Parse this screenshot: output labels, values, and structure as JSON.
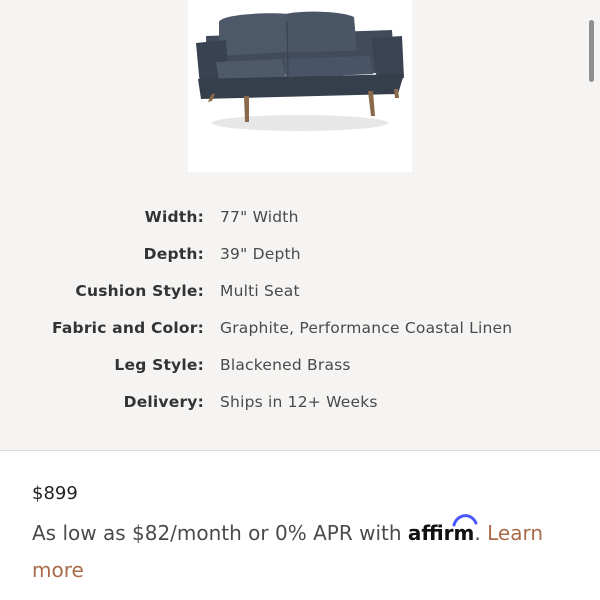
{
  "product": {
    "image_alt": "Graphite sofa",
    "price": "$899"
  },
  "specs": [
    {
      "label": "Width:",
      "value": "77\" Width"
    },
    {
      "label": "Depth:",
      "value": "39\" Depth"
    },
    {
      "label": "Cushion Style:",
      "value": "Multi Seat"
    },
    {
      "label": "Fabric and Color:",
      "value": "Graphite, Performance Coastal Linen"
    },
    {
      "label": "Leg Style:",
      "value": "Blackened Brass"
    },
    {
      "label": "Delivery:",
      "value": "Ships in 12+ Weeks"
    }
  ],
  "financing": {
    "prefix": "As low as $82/month or 0% APR with",
    "brand": "affirm",
    "suffix": ".",
    "link_label": "Learn more"
  },
  "colors": {
    "background": "#f5f4f3",
    "panel": "#ffffff",
    "link": "#a96b4a",
    "sofa": "#3f4858",
    "leg": "#8a6a4a"
  },
  "icons": {
    "sofa_image": "sofa-icon",
    "affirm_arc": "affirm-arc-icon"
  }
}
